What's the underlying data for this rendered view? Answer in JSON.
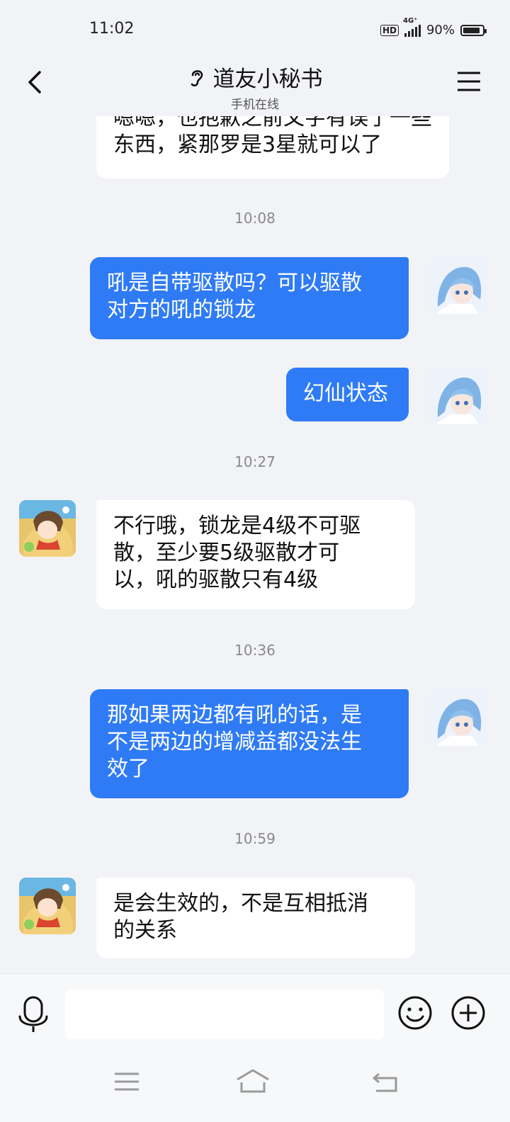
{
  "status": {
    "time": "11:02",
    "hd": "HD",
    "network": "4G⁺",
    "battery_percent": "90%",
    "battery_level": 0.9
  },
  "header": {
    "title": "道友小秘书",
    "subtitle": "手机在线",
    "back_icon": "chevron-left-icon",
    "title_icon": "ear-icon",
    "menu_icon": "hamburger-menu-icon"
  },
  "messages": [
    {
      "side": "left",
      "text_line1": "嗯嗯，也抱歉之前文字有误了一些",
      "text_line2": "东西，紧那罗是3星就可以了"
    },
    {
      "type": "timestamp",
      "text": "10:08"
    },
    {
      "side": "right",
      "text_line1": "吼是自带驱散吗？可以驱散",
      "text_line2": "对方的吼的锁龙"
    },
    {
      "side": "right",
      "text": "幻仙状态"
    },
    {
      "type": "timestamp",
      "text": "10:27"
    },
    {
      "side": "left",
      "text_line1": "不行哦，锁龙是4级不可驱",
      "text_line2": "散，至少要5级驱散才可",
      "text_line3": "以，吼的驱散只有4级"
    },
    {
      "type": "timestamp",
      "text": "10:36"
    },
    {
      "side": "right",
      "text_line1": "那如果两边都有吼的话，是",
      "text_line2": "不是两边的增减益都没法生",
      "text_line3": "效了"
    },
    {
      "type": "timestamp",
      "text": "10:59"
    },
    {
      "side": "left",
      "text_line1": "是会生效的，不是互相抵消",
      "text_line2": "的关系"
    }
  ],
  "input": {
    "voice_icon": "microphone-icon",
    "emoji_icon": "smiley-icon",
    "plus_icon": "plus-circle-icon",
    "placeholder": ""
  },
  "nav": {
    "icons": [
      "menu-icon",
      "home-icon",
      "back-icon"
    ]
  },
  "colors": {
    "accent": "#2f7bf6",
    "background": "#f2f3f7"
  }
}
